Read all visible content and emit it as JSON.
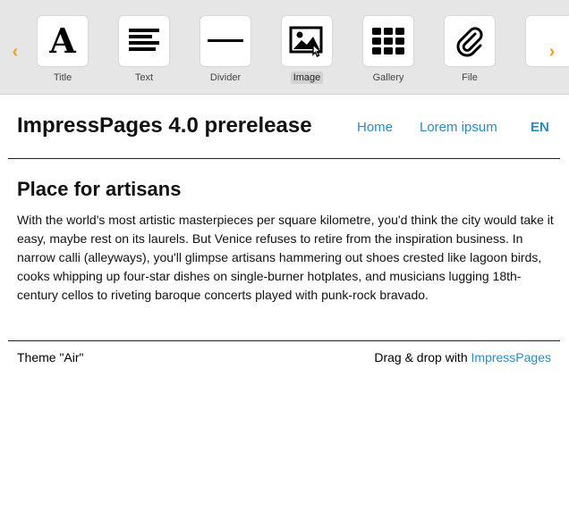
{
  "toolbar": {
    "prev_arrow": "‹",
    "next_arrow": "›",
    "widgets": [
      {
        "label": "Title",
        "icon": "title-icon"
      },
      {
        "label": "Text",
        "icon": "text-lines-icon"
      },
      {
        "label": "Divider",
        "icon": "divider-icon"
      },
      {
        "label": "Image",
        "icon": "image-icon"
      },
      {
        "label": "Gallery",
        "icon": "gallery-grid-icon"
      },
      {
        "label": "File",
        "icon": "paperclip-icon"
      }
    ],
    "title_glyph": "A",
    "active_widget": "Image",
    "accent_color": "#f0a11f"
  },
  "header": {
    "site_title": "ImpressPages 4.0 prerelease",
    "nav": [
      "Home",
      "Lorem ipsum"
    ],
    "language": "EN",
    "link_color": "#2a8bc4"
  },
  "content": {
    "heading": "Place for artisans",
    "body": "With the world's most artistic masterpieces per square kilometre, you'd think the city would take it easy, maybe rest on its laurels. But Venice refuses to retire from the inspiration business. In narrow calli (alleyways), you'll glimpse artisans hammering out shoes crested like lagoon birds, cooks whipping up four-star dishes on single-burner hotplates, and musicians lugging 18th-century cellos to riveting baroque concerts played with punk-rock bravado."
  },
  "footer": {
    "theme_text": "Theme \"Air\"",
    "credit_prefix": "Drag & drop with",
    "credit_link": "ImpressPages"
  }
}
